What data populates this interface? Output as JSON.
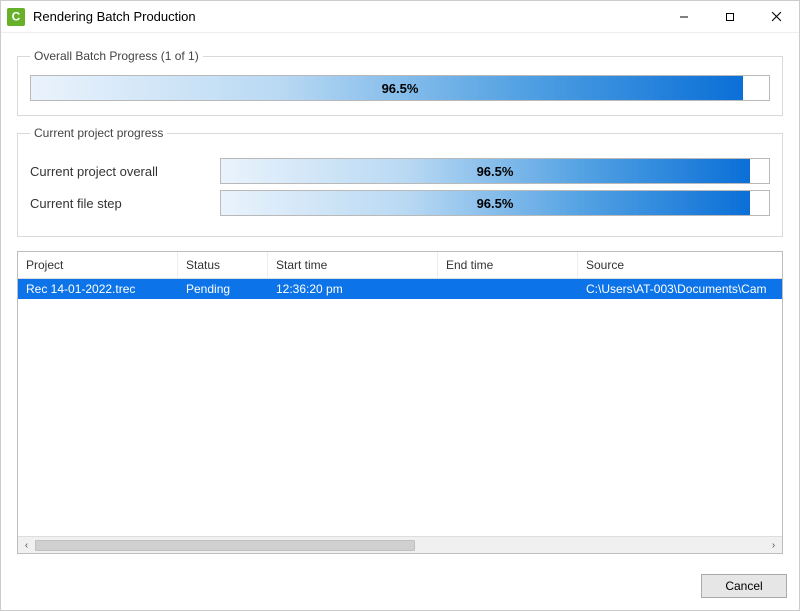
{
  "titlebar": {
    "title": "Rendering Batch Production"
  },
  "overall": {
    "legend": "Overall Batch Progress (1 of 1)",
    "percent": 96.5,
    "percent_label": "96.5%"
  },
  "current": {
    "legend": "Current project progress",
    "overall_label": "Current project overall",
    "overall_percent": 96.5,
    "overall_percent_label": "96.5%",
    "file_label": "Current file step",
    "file_percent": 96.5,
    "file_percent_label": "96.5%"
  },
  "table": {
    "headers": {
      "project": "Project",
      "status": "Status",
      "start": "Start time",
      "end": "End time",
      "source": "Source"
    },
    "rows": [
      {
        "project": "Rec 14-01-2022.trec",
        "status": "Pending",
        "start": "12:36:20 pm",
        "end": "",
        "source": "C:\\Users\\AT-003\\Documents\\Cam"
      }
    ]
  },
  "footer": {
    "cancel": "Cancel"
  }
}
